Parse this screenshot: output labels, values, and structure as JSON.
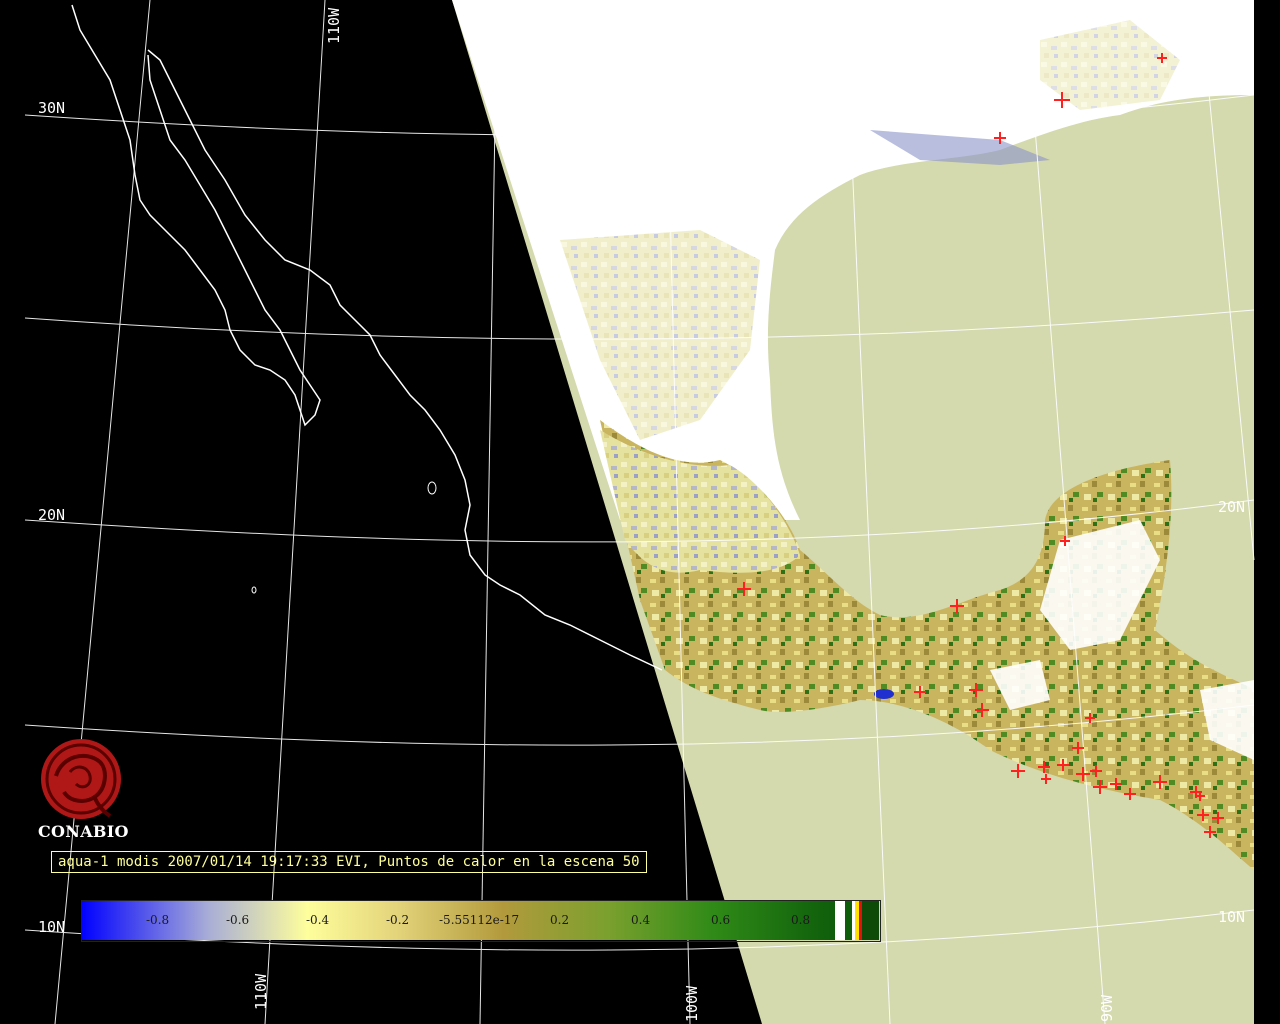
{
  "map": {
    "lat_labels": [
      "30N",
      "20N",
      "10N",
      "20N",
      "10N"
    ],
    "lon_labels": [
      "110W",
      "110W",
      "100W",
      "90W"
    ],
    "colors": {
      "night": "#000000",
      "water": "#d5d9ae",
      "cloud": "#ffffff",
      "grid": "#ffffff",
      "hotspot": "#ff2020"
    }
  },
  "logo": {
    "name": "CONABIO",
    "icon": "conabio-logo-icon"
  },
  "caption": {
    "text": "aqua-1 modis 2007/01/14 19:17:33 EVI, Puntos de calor en la escena 50"
  },
  "legend": {
    "ticks": [
      "-0.8",
      "-0.6",
      "-0.4",
      "-0.2",
      "-5.55112e-17",
      "0.2",
      "0.4",
      "0.6",
      "0.8"
    ],
    "colors": [
      "#0000ff",
      "#a9aed6",
      "#fefe9c",
      "#e3d37a",
      "#b29a3c",
      "#7aa02e",
      "#2f8a17",
      "#0e5d0b"
    ]
  }
}
